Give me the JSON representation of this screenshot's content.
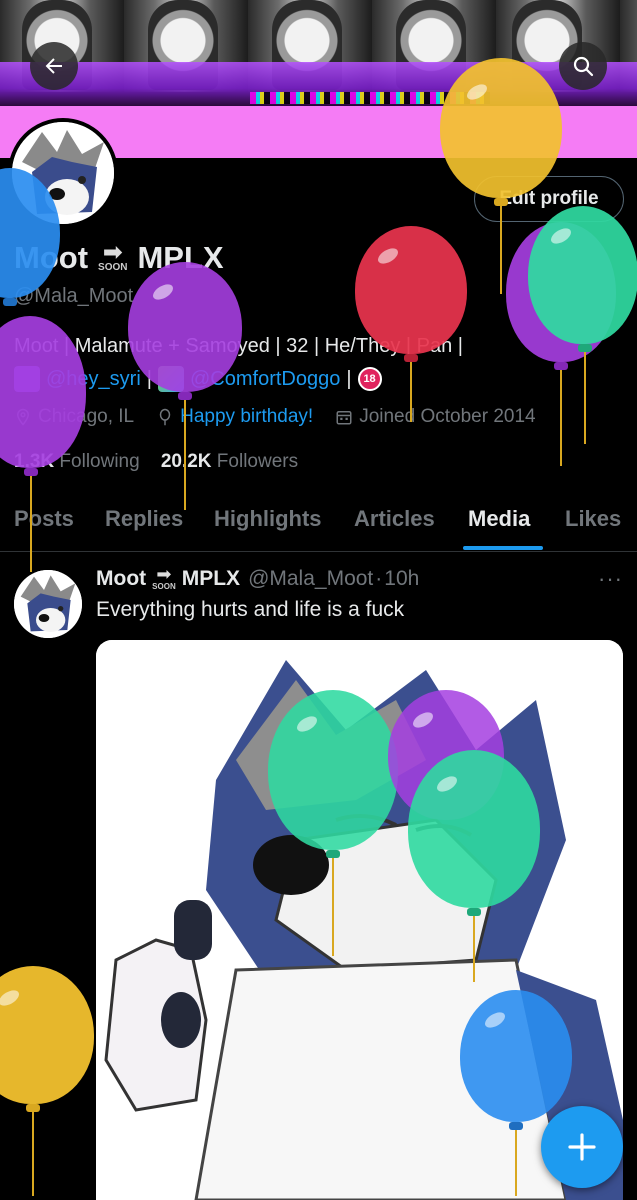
{
  "header": {
    "back_icon": "arrow-left-icon",
    "search_icon": "search-icon"
  },
  "profile": {
    "name_left": "Moot",
    "name_right": "MPLX",
    "soon_label": "SOON",
    "handle": "@Mala_Moot",
    "edit_profile_label": "Edit profile",
    "bio_line1": "Moot | Malamute + Samoyed | 32 | He/They | Pan |",
    "bio_mention1": "@hey_syri",
    "bio_sep": "|",
    "bio_mention2": "@ComfortDoggo",
    "bio_sep2": "|",
    "badge_18": "18",
    "location": "Chicago, IL",
    "birthday": "Happy birthday!",
    "joined": "Joined October 2014",
    "following_count": "1.3K",
    "following_label": "Following",
    "followers_count": "20.2K",
    "followers_label": "Followers"
  },
  "tabs": [
    "Posts",
    "Replies",
    "Highlights",
    "Articles",
    "Media",
    "Likes"
  ],
  "active_tab": "Media",
  "post": {
    "author_left": "Moot",
    "author_right": "MPLX",
    "soon_label": "SOON",
    "handle": "@Mala_Moot",
    "dot": "·",
    "time": "10h",
    "more": "···",
    "text": "Everything hurts and life is a fuck"
  },
  "fab": {
    "icon": "plus-icon"
  },
  "colors": {
    "accent": "#1d9bf0",
    "banner_pink": "#f57cf5",
    "balloon_yellow": "#f2c12e",
    "balloon_blue": "#2a8df0",
    "balloon_purple": "#a53ee0",
    "balloon_red": "#e8344e",
    "balloon_green": "#2fd9a0"
  }
}
